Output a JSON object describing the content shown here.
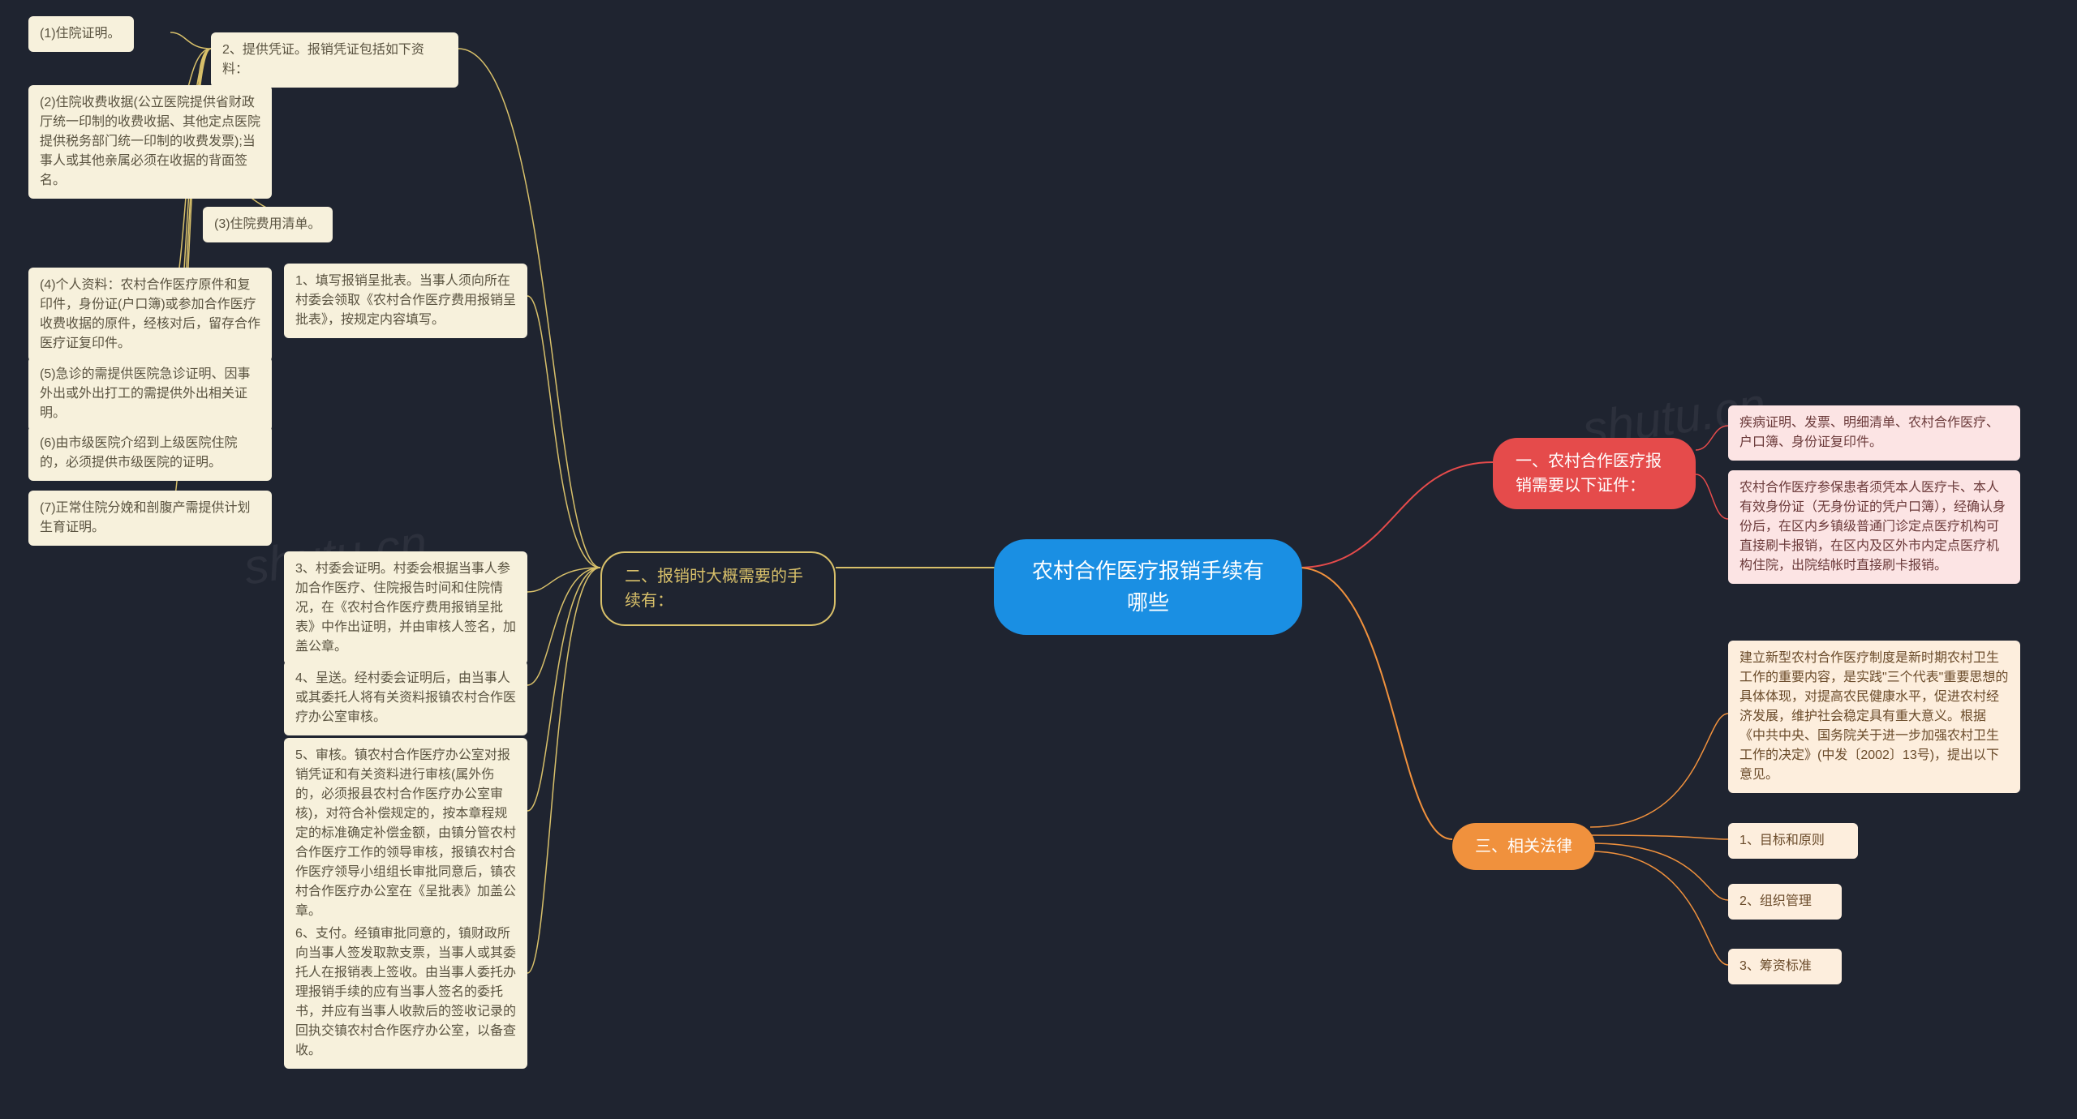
{
  "root": {
    "title": "农村合作医疗报销手续有\n哪些"
  },
  "right": {
    "b1": {
      "label": "一、农村合作医疗报销需要以下证件：",
      "leaves": [
        "疾病证明、发票、明细清单、农村合作医疗、户口簿、身份证复印件。",
        "农村合作医疗参保患者须凭本人医疗卡、本人有效身份证（无身份证的凭户口簿），经确认身份后，在区内乡镇级普通门诊定点医疗机构可直接刷卡报销，在区内及区外市内定点医疗机构住院，出院结帐时直接刷卡报销。"
      ]
    },
    "b3": {
      "label": "三、相关法律",
      "leaves": [
        "建立新型农村合作医疗制度是新时期农村卫生工作的重要内容，是实践\"三个代表\"重要思想的具体体现，对提高农民健康水平，促进农村经济发展，维护社会稳定具有重大意义。根据《中共中央、国务院关于进一步加强农村卫生工作的决定》(中发〔2002〕13号)，提出以下意见。",
        "1、目标和原则",
        "2、组织管理",
        "3、筹资标准"
      ]
    }
  },
  "left": {
    "b2": {
      "label": "二、报销时大概需要的手续有：",
      "items": [
        "1、填写报销呈批表。当事人须向所在村委会领取《农村合作医疗费用报销呈批表》，按规定内容填写。",
        "3、村委会证明。村委会根据当事人参加合作医疗、住院报告时间和住院情况，在《农村合作医疗费用报销呈批表》中作出证明，并由审核人签名，加盖公章。",
        "4、呈送。经村委会证明后，由当事人或其委托人将有关资料报镇农村合作医疗办公室审核。",
        "5、审核。镇农村合作医疗办公室对报销凭证和有关资料进行审核(属外伤的，必须报县农村合作医疗办公室审核)，对符合补偿规定的，按本章程规定的标准确定补偿金额，由镇分管农村合作医疗工作的领导审核，报镇农村合作医疗领导小组组长审批同意后，镇农村合作医疗办公室在《呈批表》加盖公章。",
        "6、支付。经镇审批同意的，镇财政所向当事人签发取款支票，当事人或其委托人在报销表上签收。由当事人委托办理报销手续的应有当事人签名的委托书，并应有当事人收款后的签收记录的回执交镇农村合作医疗办公室，以备查收。"
      ],
      "voucher": {
        "label": "2、提供凭证。报销凭证包括如下资料：",
        "subs": [
          "(1)住院证明。",
          "(2)住院收费收据(公立医院提供省财政厅统一印制的收费收据、其他定点医院提供税务部门统一印制的收费发票);当事人或其他亲属必须在收据的背面签名。",
          "(3)住院费用清单。",
          "(4)个人资料：农村合作医疗原件和复印件，身份证(户口簿)或参加合作医疗收费收据的原件，经核对后，留存合作医疗证复印件。",
          "(5)急诊的需提供医院急诊证明、因事外出或外出打工的需提供外出相关证明。",
          "(6)由市级医院介绍到上级医院住院的，必须提供市级医院的证明。",
          "(7)正常住院分娩和剖腹产需提供计划生育证明。"
        ]
      }
    }
  },
  "watermark": "shutu.cn"
}
